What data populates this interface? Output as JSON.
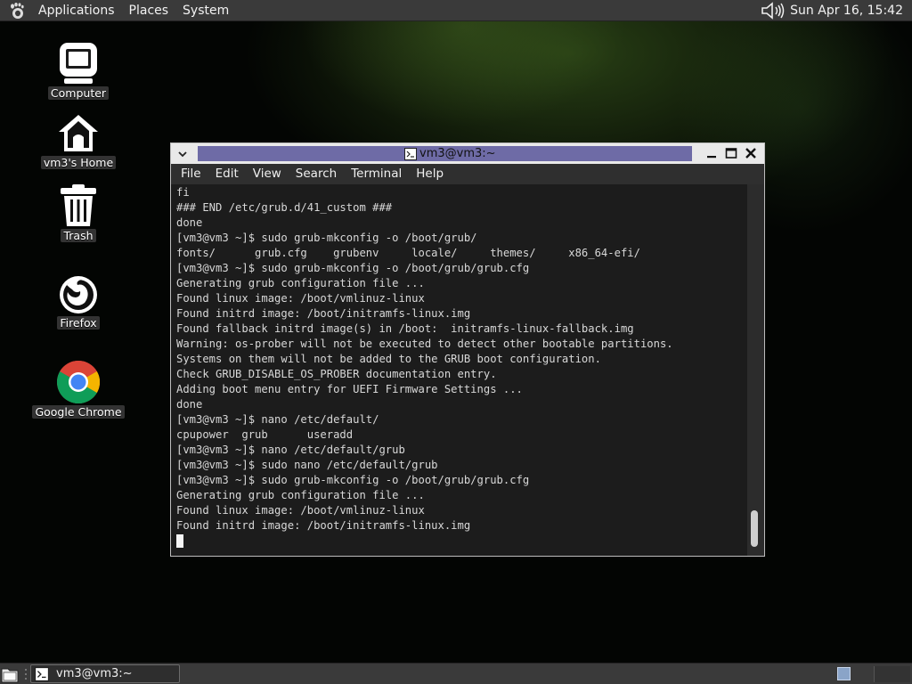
{
  "top_panel": {
    "menus": [
      "Applications",
      "Places",
      "System"
    ],
    "clock": "Sun Apr 16, 15:42"
  },
  "desktop_icons": [
    {
      "label": "Computer",
      "icon": "computer-icon"
    },
    {
      "label": "vm3's Home",
      "icon": "home-folder-icon"
    },
    {
      "label": "Trash",
      "icon": "trash-icon"
    },
    {
      "label": "Firefox",
      "icon": "firefox-icon"
    },
    {
      "label": "Google Chrome",
      "icon": "chrome-icon"
    }
  ],
  "terminal": {
    "title": "vm3@vm3:~",
    "menus": [
      "File",
      "Edit",
      "View",
      "Search",
      "Terminal",
      "Help"
    ],
    "lines": [
      "fi",
      "### END /etc/grub.d/41_custom ###",
      "done",
      "[vm3@vm3 ~]$ sudo grub-mkconfig -o /boot/grub/",
      "fonts/      grub.cfg    grubenv     locale/     themes/     x86_64-efi/",
      "[vm3@vm3 ~]$ sudo grub-mkconfig -o /boot/grub/grub.cfg",
      "Generating grub configuration file ...",
      "Found linux image: /boot/vmlinuz-linux",
      "Found initrd image: /boot/initramfs-linux.img",
      "Found fallback initrd image(s) in /boot:  initramfs-linux-fallback.img",
      "Warning: os-prober will not be executed to detect other bootable partitions.",
      "Systems on them will not be added to the GRUB boot configuration.",
      "Check GRUB_DISABLE_OS_PROBER documentation entry.",
      "Adding boot menu entry for UEFI Firmware Settings ...",
      "done",
      "[vm3@vm3 ~]$ nano /etc/default/",
      "cpupower  grub      useradd",
      "[vm3@vm3 ~]$ nano /etc/default/grub",
      "[vm3@vm3 ~]$ sudo nano /etc/default/grub",
      "[vm3@vm3 ~]$ sudo grub-mkconfig -o /boot/grub/grub.cfg",
      "Generating grub configuration file ...",
      "Found linux image: /boot/vmlinuz-linux",
      "Found initrd image: /boot/initramfs-linux.img"
    ]
  },
  "taskbar": {
    "items": [
      {
        "label": "vm3@vm3:~"
      }
    ]
  },
  "colors": {
    "panel": "#3a3a3a",
    "title_active": "#6e6ba6",
    "terminal_bg": "#1c1c1c",
    "terminal_fg": "#d8d8d8"
  }
}
